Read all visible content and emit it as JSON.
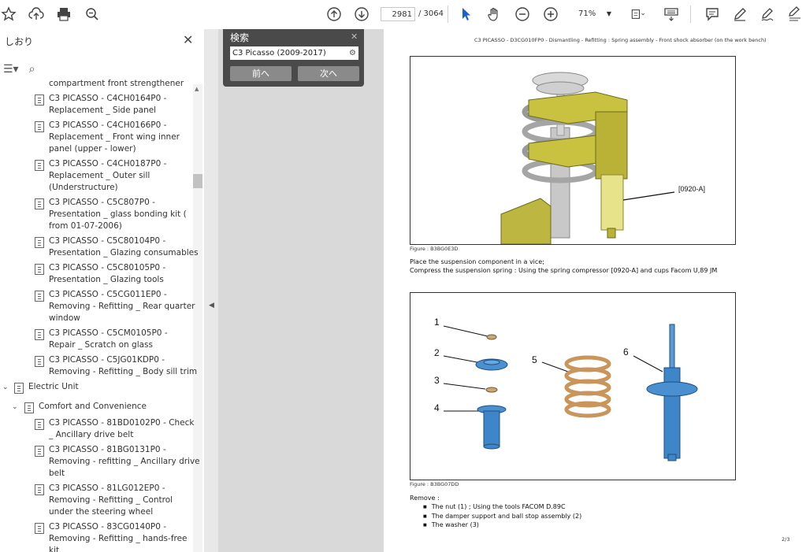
{
  "toolbar": {
    "page_current": "2981",
    "page_total": "/ 3064",
    "zoom": "71%"
  },
  "sidebar": {
    "title": "しおり",
    "items": [
      {
        "lines": [
          "compartment front strengthener"
        ]
      },
      {
        "lines": [
          "C3 PICASSO - C4CH0164P0 -",
          "Replacement _ Side panel"
        ]
      },
      {
        "lines": [
          "C3 PICASSO - C4CH0166P0 -",
          "Replacement _ Front wing inner",
          "panel (upper - lower)"
        ]
      },
      {
        "lines": [
          "C3 PICASSO - C4CH0187P0 -",
          "Replacement _ Outer sill",
          "(Understructure)"
        ]
      },
      {
        "lines": [
          "C3 PICASSO - C5C807P0 -",
          "Presentation _ glass bonding kit (",
          "from 01-07-2006)"
        ]
      },
      {
        "lines": [
          "C3 PICASSO - C5C80104P0 -",
          "Presentation _ Glazing consumables"
        ]
      },
      {
        "lines": [
          "C3 PICASSO - C5C80105P0 -",
          "Presentation _ Glazing tools"
        ]
      },
      {
        "lines": [
          "C3 PICASSO - C5CG011EP0 -",
          "Removing - Refitting _ Rear quarter",
          "window"
        ]
      },
      {
        "lines": [
          "C3 PICASSO - C5CM0105P0 -",
          "Repair _ Scratch on glass"
        ]
      },
      {
        "lines": [
          "C3 PICASSO - C5JG01KDP0 -",
          "Removing - Refitting _ Body sill trim"
        ]
      }
    ],
    "group": "Electric Unit",
    "subgroup": "Comfort and Convenience",
    "sub_items": [
      {
        "lines": [
          "C3 PICASSO - 81BD0102P0 - Check",
          "_ Ancillary drive belt"
        ]
      },
      {
        "lines": [
          "C3 PICASSO - 81BG0131P0 -",
          "Removing - refitting _ Ancillary drive",
          "belt"
        ]
      },
      {
        "lines": [
          "C3 PICASSO - 81LG012EP0 -",
          "Removing - Refitting _ Control",
          "under the steering wheel"
        ]
      },
      {
        "lines": [
          "C3 PICASSO - 83CG0140P0 -",
          "Removing - Refitting _ hands-free",
          "kit"
        ]
      }
    ]
  },
  "search": {
    "title": "検索",
    "query": "C3 Picasso (2009-2017)",
    "prev": "前へ",
    "next": "次へ"
  },
  "page": {
    "header": "C3 PICASSO - D3CG010FP0 - Dismantling - Refitting : Spring assembly - Front shock absorber (on the work bench)",
    "fig1_caption": "Figure : B3BG0E3D",
    "fig1_label": "[0920-A]",
    "line1": "Place the suspension component in a vice;",
    "line2": "Compress the suspension spring : Using the spring compressor [0920-A] and cups Facom U,89 JM",
    "fig2_caption": "Figure : B3BG07DD",
    "callouts": [
      "1",
      "2",
      "3",
      "4",
      "5",
      "6"
    ],
    "remove_title": "Remove :",
    "remove_items": [
      "The nut (1) ; Using the tools FACOM D.89C",
      "The damper support and ball stop assembly (2)",
      "The washer (3)"
    ],
    "page_number": "2/3"
  }
}
